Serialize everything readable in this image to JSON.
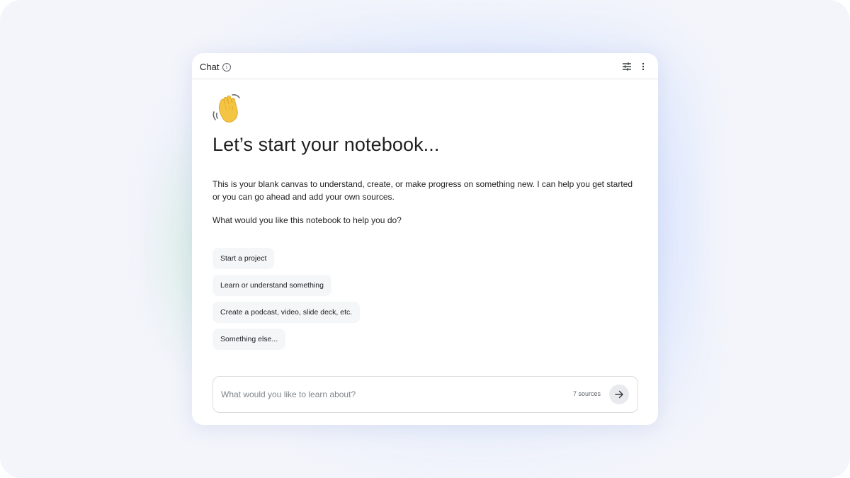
{
  "panel": {
    "title": "Chat",
    "info_icon": "info-icon",
    "settings_icon": "tune-icon",
    "menu_icon": "more-vert-icon"
  },
  "welcome": {
    "emoji_icon": "waving-hand-icon",
    "headline": "Let’s start your notebook...",
    "intro": "This is your blank canvas to understand, create, or make progress on something new. I can help you get started or you can go ahead and add your own sources.",
    "question": "What would you like this notebook to help you do?"
  },
  "suggestions": [
    {
      "label": "Start a project"
    },
    {
      "label": "Learn or understand something"
    },
    {
      "label": "Create a podcast, video, slide deck, etc."
    },
    {
      "label": "Something else..."
    }
  ],
  "composer": {
    "placeholder": "What would you like to learn about?",
    "source_count": "7 sources",
    "send_icon": "arrow-right-icon"
  },
  "colors": {
    "background": "#f3f5fb",
    "panel": "#ffffff",
    "chip": "#f5f6f8",
    "text": "#1f1f1f",
    "muted": "#80868b",
    "send_button": "#e8eaed"
  }
}
